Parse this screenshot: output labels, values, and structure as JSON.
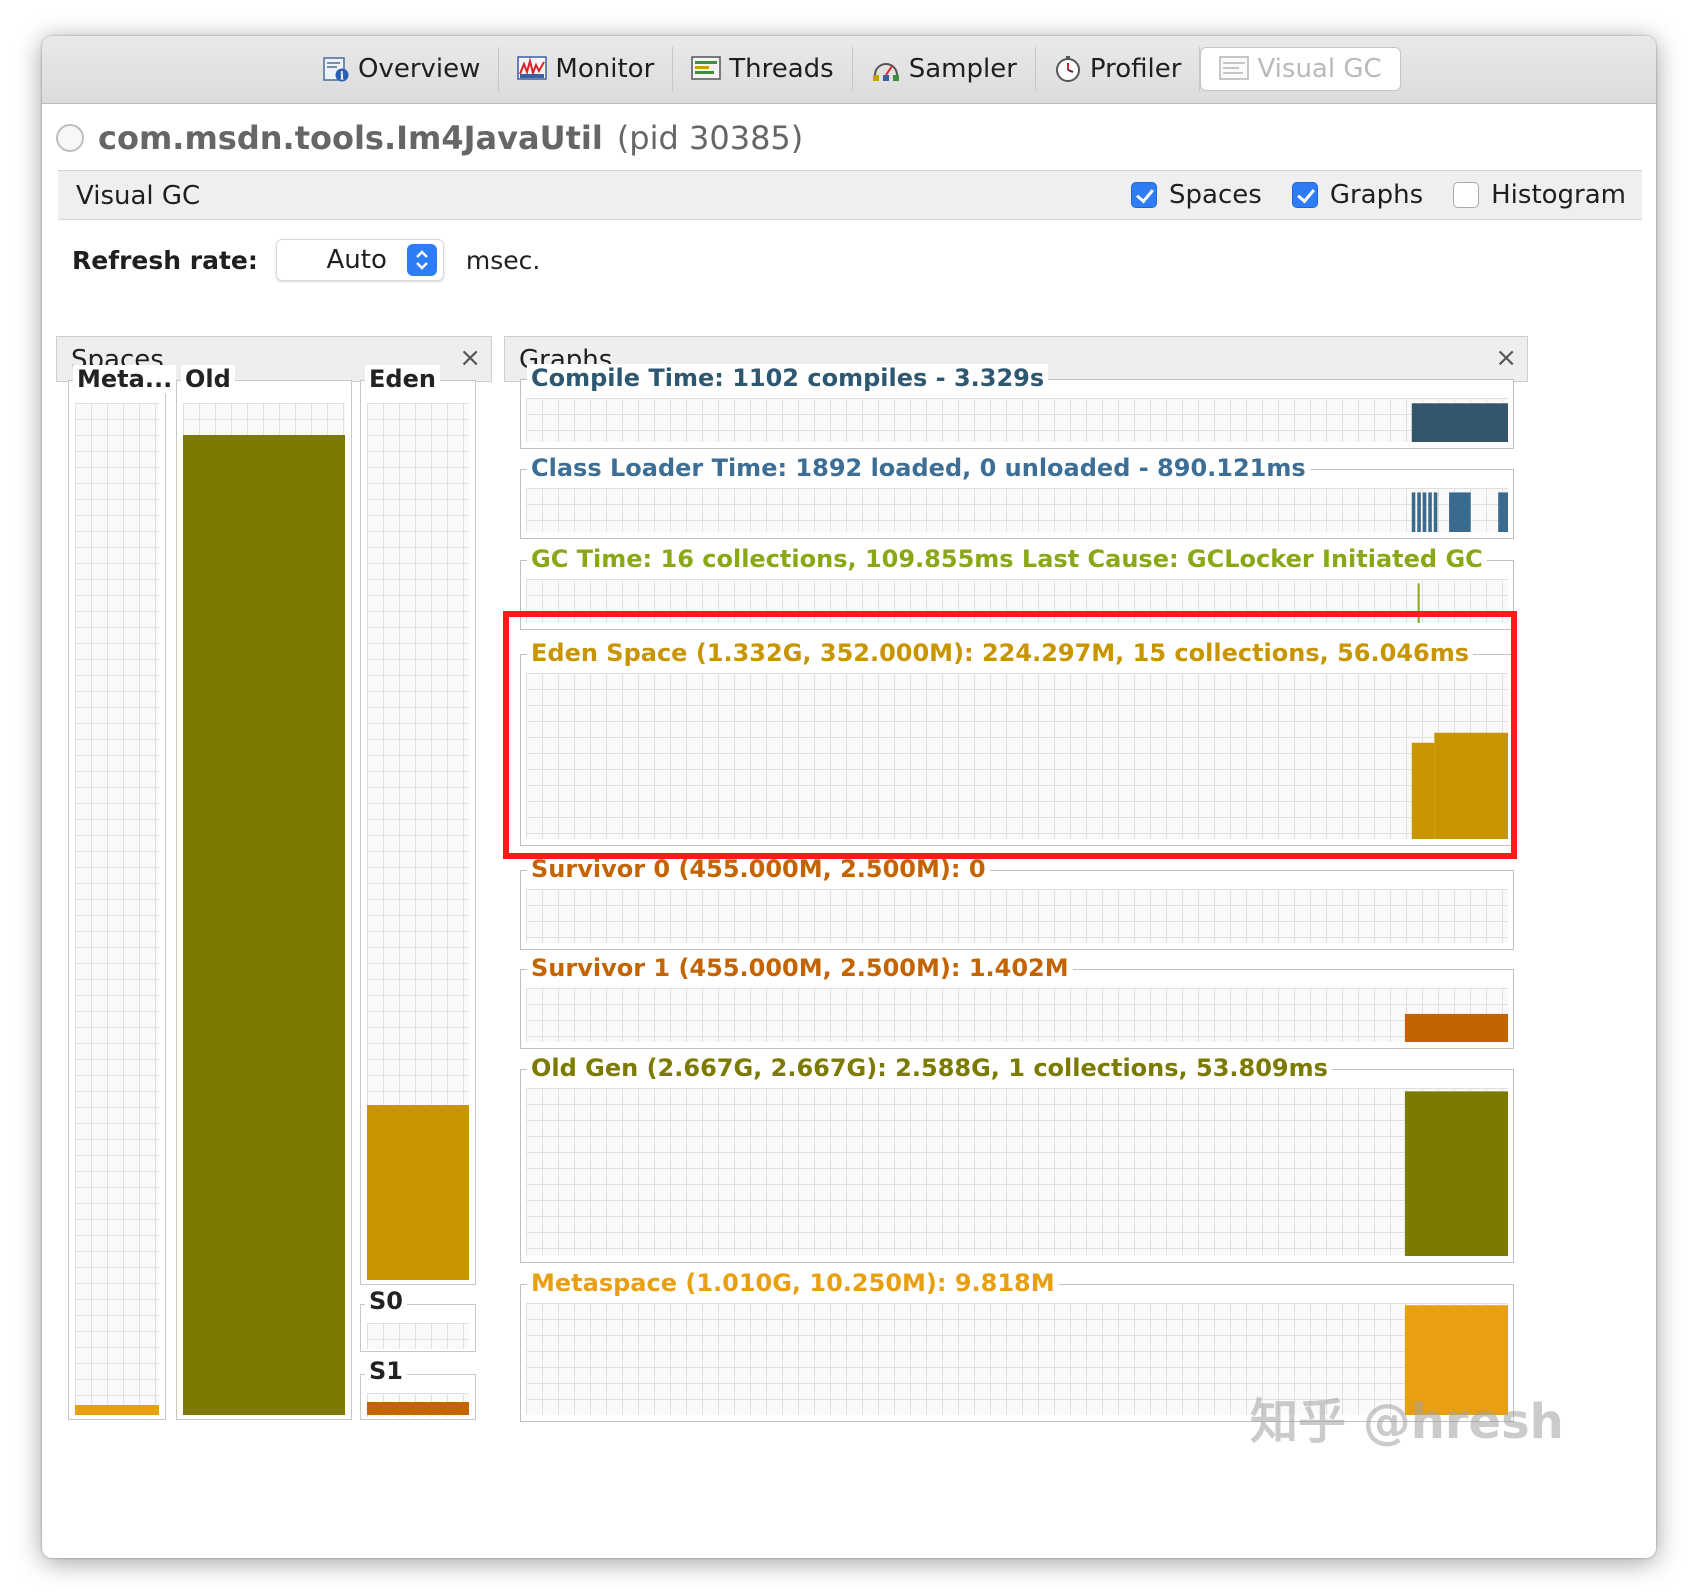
{
  "tabs": [
    {
      "label": "Overview",
      "icon": "overview-icon"
    },
    {
      "label": "Monitor",
      "icon": "monitor-icon"
    },
    {
      "label": "Threads",
      "icon": "threads-icon"
    },
    {
      "label": "Sampler",
      "icon": "sampler-icon"
    },
    {
      "label": "Profiler",
      "icon": "profiler-icon"
    },
    {
      "label": "Visual GC",
      "icon": "visual-gc-icon",
      "active": true
    }
  ],
  "app": {
    "name": "com.msdn.tools.Im4JavaUtil",
    "pid": "(pid 30385)"
  },
  "visual_gc": {
    "title": "Visual GC",
    "options": [
      {
        "label": "Spaces",
        "checked": true
      },
      {
        "label": "Graphs",
        "checked": true
      },
      {
        "label": "Histogram",
        "checked": false
      }
    ]
  },
  "refresh": {
    "label": "Refresh rate:",
    "value": "Auto",
    "unit": "msec."
  },
  "spaces_panel": {
    "title": "Spaces",
    "close": "×",
    "columns": [
      {
        "label": "Meta...",
        "fill_fraction": 0.01,
        "color": "#e8a012"
      },
      {
        "label": "Old",
        "fill_fraction": 0.97,
        "color": "#7c7a00"
      },
      {
        "label": "Eden",
        "fill_fraction": 0.2,
        "color": "#c89400"
      },
      {
        "label": "S0",
        "fill_fraction": 0.0,
        "color": "#c46400"
      },
      {
        "label": "S1",
        "fill_fraction": 0.56,
        "color": "#c46400"
      }
    ]
  },
  "graphs_panel": {
    "title": "Graphs",
    "close": "×",
    "graphs": [
      {
        "title": "Compile Time: 1102 compiles - 3.329s",
        "color": "#2e5872",
        "fill": "#34566c"
      },
      {
        "title": "Class Loader Time: 1892 loaded, 0 unloaded - 890.121ms",
        "color": "#3d6f96",
        "fill": "#3a6a8e"
      },
      {
        "title": "GC Time: 16 collections, 109.855ms Last Cause: GCLocker Initiated GC",
        "color": "#8aa816",
        "fill": "#8aa816"
      },
      {
        "title": "Eden Space (1.332G, 352.000M): 224.297M, 15 collections, 56.046ms",
        "color": "#c89400",
        "fill": "#c89400"
      },
      {
        "title": "Survivor 0 (455.000M, 2.500M): 0",
        "color": "#c46400",
        "fill": "#c46400"
      },
      {
        "title": "Survivor 1 (455.000M, 2.500M): 1.402M",
        "color": "#c46400",
        "fill": "#c46400"
      },
      {
        "title": "Old Gen (2.667G, 2.667G): 2.588G, 1 collections, 53.809ms",
        "color": "#7c7a00",
        "fill": "#7c7a00"
      },
      {
        "title": "Metaspace (1.010G, 10.250M): 9.818M",
        "color": "#e8a012",
        "fill": "#e8a012"
      }
    ]
  },
  "watermark": "知乎 @hresh"
}
